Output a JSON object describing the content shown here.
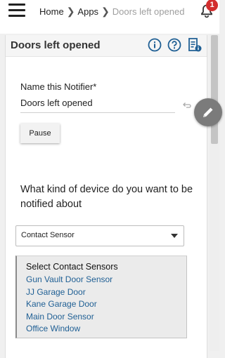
{
  "header": {
    "breadcrumb": {
      "home": "Home",
      "apps": "Apps",
      "current": "Doors left opened"
    },
    "notifications": {
      "count": "1"
    }
  },
  "app": {
    "title": "Doors left opened",
    "name_field": {
      "label": "Name this Notifier*",
      "value": "Doors left opened"
    },
    "pause_button": "Pause",
    "question": "What kind of device do you want to be notified about",
    "device_type": {
      "selected": "Contact Sensor"
    },
    "sensors": {
      "title": "Select Contact Sensors",
      "items": [
        "Gun Vault Door Sensor",
        "JJ Garage Door",
        "Kane Garage Door",
        "Main Door Sensor",
        "Office Window"
      ]
    }
  },
  "colors": {
    "accent_blue": "#1f5f94",
    "badge_red": "#d32f2f",
    "fab_gray": "#7b7b7b"
  }
}
